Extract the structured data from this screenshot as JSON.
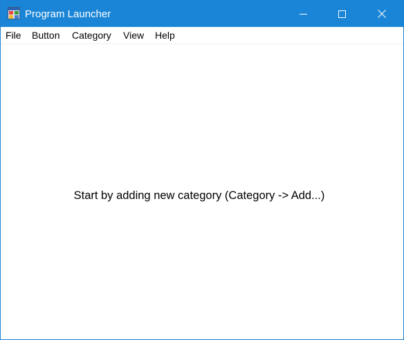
{
  "window": {
    "title": "Program Launcher",
    "app_icon": "program-launcher-app-icon",
    "controls": {
      "minimize_icon": "minimize-icon",
      "maximize_icon": "maximize-icon",
      "close_icon": "close-icon"
    }
  },
  "menu": {
    "file": "File",
    "button": "Button",
    "category": "Category",
    "view": "View",
    "help": "Help"
  },
  "main": {
    "hint": "Start by adding new category (Category -> Add...)"
  },
  "colors": {
    "titlebar": "#1a85d6",
    "window_border": "#1f7fd6",
    "background": "#ffffff"
  }
}
